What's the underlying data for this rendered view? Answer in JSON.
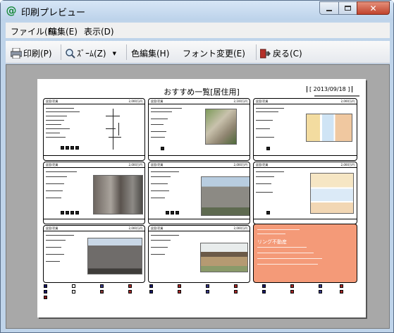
{
  "window": {
    "title": "印刷プレビュー",
    "icon": "at-sign-icon"
  },
  "menus": [
    "ファイル(F)",
    "編集(E)",
    "表示(D)"
  ],
  "toolbar": {
    "print": "印刷(P)",
    "zoom": "ｽﾞｰﾑ(Z)",
    "color_edit": "色編集(H)",
    "font_change": "フォント変更(E)",
    "back": "戻る(C)"
  },
  "page": {
    "title": "おすすめ一覧[居住用]",
    "date": "[ 2013/09/18 ]"
  },
  "cards": [
    {
      "type": "居室/売買",
      "price": "2,000万円"
    },
    {
      "type": "居室/売買",
      "price": "2,100万円"
    },
    {
      "type": "居室/売買",
      "price": "2,000万円"
    },
    {
      "type": "居室/売買",
      "price": "2,000万円"
    },
    {
      "type": "居室/売買",
      "price": "2,000万円"
    },
    {
      "type": "居室/売買",
      "price": "2,000万円"
    },
    {
      "type": "居室/売買",
      "price": "2,000万円"
    },
    {
      "type": "居室/売買",
      "price": "2,000万円"
    }
  ],
  "company": {
    "name": "リング不動産"
  },
  "colors": {
    "accent": "#f49a78",
    "titlebar": "#c9dcf0",
    "close": "#c0432c"
  }
}
